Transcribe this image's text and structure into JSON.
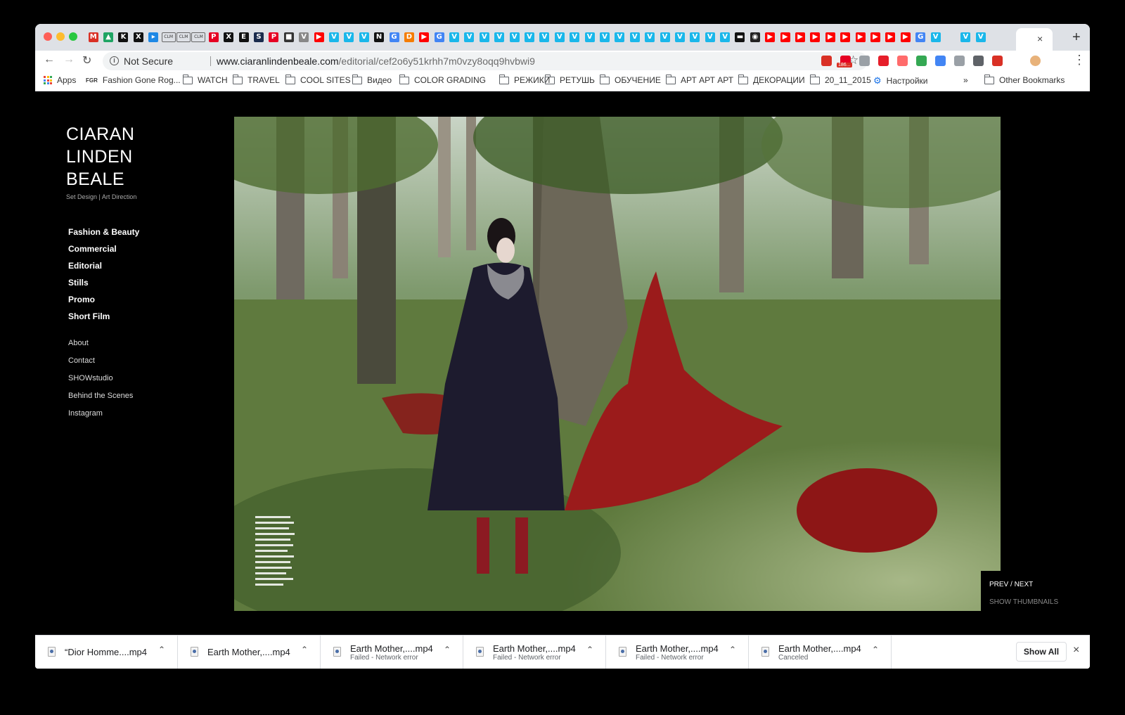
{
  "browser": {
    "tab_favicons": [
      {
        "icon": "gmail-icon",
        "glyph": "M",
        "color": "#d93025"
      },
      {
        "icon": "drive-icon",
        "glyph": "▲",
        "color": "#1fa463"
      },
      {
        "icon": "site-icon",
        "glyph": "K",
        "color": "#111111"
      },
      {
        "icon": "site-icon",
        "glyph": "X",
        "color": "#111111"
      },
      {
        "icon": "site-icon",
        "glyph": "▸",
        "color": "#1e88e5"
      },
      {
        "icon": "clm-icon",
        "glyph": "CLM",
        "color": "clm"
      },
      {
        "icon": "clm-icon",
        "glyph": "CLM",
        "color": "clm"
      },
      {
        "icon": "clm-icon",
        "glyph": "CLM",
        "color": "clm"
      },
      {
        "icon": "pinterest-icon",
        "glyph": "P",
        "color": "#e60023"
      },
      {
        "icon": "site-icon",
        "glyph": "X",
        "color": "#111111"
      },
      {
        "icon": "site-icon",
        "glyph": "E",
        "color": "#111111"
      },
      {
        "icon": "site-icon",
        "glyph": "S",
        "color": "#1a2b4c"
      },
      {
        "icon": "pinterest-icon",
        "glyph": "P",
        "color": "#e60023"
      },
      {
        "icon": "site-icon",
        "glyph": "■",
        "color": "#333333"
      },
      {
        "icon": "site-icon",
        "glyph": "V",
        "color": "#888888"
      },
      {
        "icon": "youtube-icon",
        "glyph": "▶",
        "color": "#ff0000"
      },
      {
        "icon": "vimeo-icon",
        "glyph": "V",
        "color": "#1ab7ea"
      },
      {
        "icon": "vimeo-icon",
        "glyph": "V",
        "color": "#1ab7ea"
      },
      {
        "icon": "vimeo-icon",
        "glyph": "V",
        "color": "#1ab7ea"
      },
      {
        "icon": "site-icon",
        "glyph": "N",
        "color": "#111111"
      },
      {
        "icon": "google-icon",
        "glyph": "G",
        "color": "#4285f4"
      },
      {
        "icon": "site-icon",
        "glyph": "D",
        "color": "#f57c00"
      },
      {
        "icon": "youtube-icon",
        "glyph": "▶",
        "color": "#ff0000"
      },
      {
        "icon": "google-icon",
        "glyph": "G",
        "color": "#4285f4"
      },
      {
        "icon": "vimeo-icon",
        "glyph": "V",
        "color": "#1ab7ea"
      },
      {
        "icon": "vimeo-icon",
        "glyph": "V",
        "color": "#1ab7ea"
      },
      {
        "icon": "vimeo-icon",
        "glyph": "V",
        "color": "#1ab7ea"
      },
      {
        "icon": "vimeo-icon",
        "glyph": "V",
        "color": "#1ab7ea"
      },
      {
        "icon": "vimeo-icon",
        "glyph": "V",
        "color": "#1ab7ea"
      },
      {
        "icon": "vimeo-icon",
        "glyph": "V",
        "color": "#1ab7ea"
      },
      {
        "icon": "vimeo-icon",
        "glyph": "V",
        "color": "#1ab7ea"
      },
      {
        "icon": "vimeo-icon",
        "glyph": "V",
        "color": "#1ab7ea"
      },
      {
        "icon": "vimeo-icon",
        "glyph": "V",
        "color": "#1ab7ea"
      },
      {
        "icon": "vimeo-icon",
        "glyph": "V",
        "color": "#1ab7ea"
      },
      {
        "icon": "vimeo-icon",
        "glyph": "V",
        "color": "#1ab7ea"
      },
      {
        "icon": "vimeo-icon",
        "glyph": "V",
        "color": "#1ab7ea"
      },
      {
        "icon": "vimeo-icon",
        "glyph": "V",
        "color": "#1ab7ea"
      },
      {
        "icon": "vimeo-icon",
        "glyph": "V",
        "color": "#1ab7ea"
      },
      {
        "icon": "vimeo-icon",
        "glyph": "V",
        "color": "#1ab7ea"
      },
      {
        "icon": "vimeo-icon",
        "glyph": "V",
        "color": "#1ab7ea"
      },
      {
        "icon": "vimeo-icon",
        "glyph": "V",
        "color": "#1ab7ea"
      },
      {
        "icon": "vimeo-icon",
        "glyph": "V",
        "color": "#1ab7ea"
      },
      {
        "icon": "vimeo-icon",
        "glyph": "V",
        "color": "#1ab7ea"
      },
      {
        "icon": "site-icon",
        "glyph": "▬",
        "color": "#111111"
      },
      {
        "icon": "site-icon",
        "glyph": "◉",
        "color": "#222222"
      },
      {
        "icon": "youtube-icon",
        "glyph": "▶",
        "color": "#ff0000"
      },
      {
        "icon": "youtube-icon",
        "glyph": "▶",
        "color": "#ff0000"
      },
      {
        "icon": "youtube-icon",
        "glyph": "▶",
        "color": "#ff0000"
      },
      {
        "icon": "youtube-icon",
        "glyph": "▶",
        "color": "#ff0000"
      },
      {
        "icon": "youtube-icon",
        "glyph": "▶",
        "color": "#ff0000"
      },
      {
        "icon": "youtube-icon",
        "glyph": "▶",
        "color": "#ff0000"
      },
      {
        "icon": "youtube-icon",
        "glyph": "▶",
        "color": "#ff0000"
      },
      {
        "icon": "youtube-icon",
        "glyph": "▶",
        "color": "#ff0000"
      },
      {
        "icon": "youtube-icon",
        "glyph": "▶",
        "color": "#ff0000"
      },
      {
        "icon": "youtube-icon",
        "glyph": "▶",
        "color": "#ff0000"
      },
      {
        "icon": "google-icon",
        "glyph": "G",
        "color": "#4285f4"
      },
      {
        "icon": "vimeo-icon",
        "glyph": "V",
        "color": "#1ab7ea"
      },
      {
        "icon": "blank-icon",
        "glyph": "",
        "color": "transparent"
      },
      {
        "icon": "vimeo-icon",
        "glyph": "V",
        "color": "#1ab7ea"
      },
      {
        "icon": "vimeo-icon",
        "glyph": "V",
        "color": "#1ab7ea"
      }
    ],
    "active_tab_close": "×",
    "new_tab": "+",
    "not_secure": "Not Secure",
    "url_host": "www.ciaranlindenbeale.com",
    "url_path": "/editorial/cef2o6y51krhh7m0vzy8oqq9hvbwi9",
    "gmail_badge": "186...",
    "extensions": [
      {
        "icon": "gmail-ext-icon",
        "color": "#d93025"
      },
      {
        "icon": "pinterest-ext-icon",
        "color": "#e60023"
      },
      {
        "icon": "grid-ext-icon",
        "color": "#9aa0a6"
      },
      {
        "icon": "opera-ext-icon",
        "color": "#e61e2a"
      },
      {
        "icon": "arrow-ext-icon",
        "color": "#ff6b6b"
      },
      {
        "icon": "puzzle-ext-icon",
        "color": "#34a853"
      },
      {
        "icon": "sync-ext-icon",
        "color": "#4285f4"
      },
      {
        "icon": "shield-ext-icon",
        "color": "#9aa0a6"
      },
      {
        "icon": "pocket-ext-icon",
        "color": "#5f6368"
      },
      {
        "icon": "pin-ext-icon",
        "color": "#d93025"
      },
      {
        "icon": "avatar-icon",
        "color": "#e8b27a"
      }
    ]
  },
  "bookmarks": {
    "apps": "Apps",
    "fgr_logo": "FGR",
    "items": [
      {
        "label": "Fashion Gone Rog...",
        "type": "site"
      },
      {
        "label": "WATCH",
        "type": "folder"
      },
      {
        "label": "TRAVEL",
        "type": "folder"
      },
      {
        "label": "COOL SITES",
        "type": "folder"
      },
      {
        "label": "Видео",
        "type": "folder"
      },
      {
        "label": "COLOR GRADING",
        "type": "folder"
      },
      {
        "label": "РЕЖИКИ",
        "type": "folder"
      },
      {
        "label": "РЕТУШЬ",
        "type": "folder"
      },
      {
        "label": "ОБУЧЕНИЕ",
        "type": "folder"
      },
      {
        "label": "АРТ АРТ АРТ",
        "type": "folder"
      },
      {
        "label": "ДЕКОРАЦИИ",
        "type": "folder"
      },
      {
        "label": "20_11_2015",
        "type": "folder"
      },
      {
        "label": "Настройки",
        "type": "gear"
      }
    ],
    "overflow": "»",
    "other": "Other Bookmarks"
  },
  "site": {
    "brand_lines": [
      "CIARAN",
      "LINDEN",
      "BEALE"
    ],
    "tagline": "Set Design  |  Art Direction",
    "primary_nav": [
      "Fashion & Beauty",
      "Commercial",
      "Editorial",
      "Stills",
      "Promo",
      "Short Film"
    ],
    "secondary_nav": [
      "About",
      "Contact",
      "SHOWstudio",
      "Behind the Scenes",
      "Instagram"
    ],
    "pager": "PREV / NEXT",
    "thumbnails": "SHOW THUMBNAILS"
  },
  "downloads": {
    "items": [
      {
        "name": "“Dior Homme....mp4",
        "status": ""
      },
      {
        "name": "Earth Mother,....mp4",
        "status": ""
      },
      {
        "name": "Earth Mother,....mp4",
        "status": "Failed - Network error"
      },
      {
        "name": "Earth Mother,....mp4",
        "status": "Failed - Network error"
      },
      {
        "name": "Earth Mother,....mp4",
        "status": "Failed - Network error"
      },
      {
        "name": "Earth Mother,....mp4",
        "status": "Canceled"
      }
    ],
    "show_all": "Show All",
    "close": "×"
  }
}
